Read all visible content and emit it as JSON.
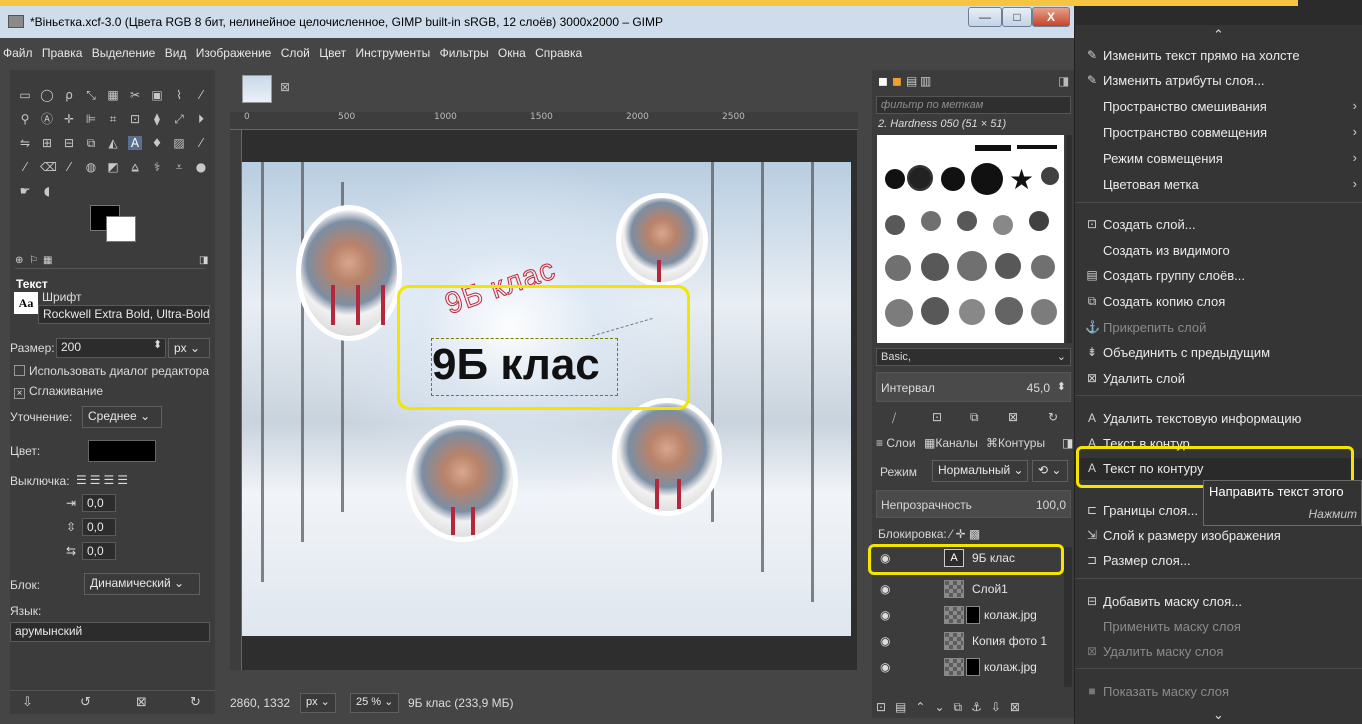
{
  "window": {
    "title": "*Віньєтка.xcf-3.0 (Цвета RGB 8 бит, нелинейное целочисленное, GIMP built-in sRGB, 12 слоёв) 3000x2000 – GIMP",
    "minimize": "—",
    "maximize": "□",
    "close": "X"
  },
  "menubar": [
    "Файл",
    "Правка",
    "Выделение",
    "Вид",
    "Изображение",
    "Слой",
    "Цвет",
    "Инструменты",
    "Фильтры",
    "Окна",
    "Справка"
  ],
  "tool_options": {
    "title": "Текст",
    "font_label": "Шрифт",
    "font_value": "Rockwell Extra Bold, Ultra-Bold",
    "size_label": "Размер:",
    "size_value": "200",
    "size_unit": "px",
    "use_editor": "Использовать диалог редактора",
    "antialias": "Сглаживание",
    "hinting_label": "Уточнение:",
    "hinting_value": "Среднее",
    "color_label": "Цвет:",
    "justify_label": "Выключка:",
    "indent": "0,0",
    "line_spacing": "0,0",
    "letter_spacing": "0,0",
    "box_label": "Блок:",
    "box_value": "Динамический",
    "lang_label": "Язык:",
    "lang_value": "арумынский",
    "fg_color": "#000000",
    "bg_color": "#ffffff"
  },
  "ruler": [
    "0",
    "500",
    "1000",
    "1500",
    "2000",
    "2500"
  ],
  "canvas": {
    "text": "9Б клас",
    "path_text": "9Б клас"
  },
  "status": {
    "coords": "2860, 1332",
    "unit": "px",
    "zoom": "25 %",
    "info": "9Б клас (233,9 МБ)"
  },
  "brushes": {
    "filter_placeholder": "фильтр по меткам",
    "current": "2. Hardness 050 (51 × 51)",
    "preset": "Basic,",
    "interval_label": "Интервал",
    "interval_value": "45,0"
  },
  "layers_dock": {
    "tabs": [
      "Слои",
      "Каналы",
      "Контуры"
    ],
    "mode_label": "Режим",
    "mode_value": "Нормальный",
    "opacity_label": "Непрозрачность",
    "opacity_value": "100,0",
    "lock_label": "Блокировка:",
    "layers": [
      "9Б клас",
      "Слой1",
      "колаж.jpg",
      "Копия фото 1",
      "колаж.jpg"
    ]
  },
  "context_menu": {
    "items": [
      {
        "label": "Изменить текст прямо на холсте",
        "icon": "pencil-icon"
      },
      {
        "label": "Изменить атрибуты слоя...",
        "icon": "pencil-icon"
      },
      {
        "label": "Пространство смешивания",
        "submenu": true
      },
      {
        "label": "Пространство совмещения",
        "submenu": true
      },
      {
        "label": "Режим совмещения",
        "submenu": true
      },
      {
        "label": "Цветовая метка",
        "submenu": true
      },
      {
        "label": "Создать слой...",
        "icon": "new-layer-icon"
      },
      {
        "label": "Создать из видимого"
      },
      {
        "label": "Создать группу слоёв...",
        "icon": "folder-icon"
      },
      {
        "label": "Создать копию слоя",
        "icon": "duplicate-icon"
      },
      {
        "label": "Прикрепить слой",
        "icon": "anchor-icon",
        "disabled": true
      },
      {
        "label": "Объединить с предыдущим",
        "icon": "merge-icon"
      },
      {
        "label": "Удалить слой",
        "icon": "delete-icon"
      },
      {
        "label": "Удалить текстовую информацию",
        "icon": "text-icon"
      },
      {
        "label": "Текст в контур",
        "icon": "text-icon"
      },
      {
        "label": "Текст по контуру",
        "icon": "text-icon"
      },
      {
        "label": "Границы слоя...",
        "icon": "bounds-icon"
      },
      {
        "label": "Слой к размеру изображения",
        "icon": "resize-icon"
      },
      {
        "label": "Размер слоя...",
        "icon": "scale-icon"
      },
      {
        "label": "Добавить маску слоя...",
        "icon": "mask-icon"
      },
      {
        "label": "Применить маску слоя",
        "disabled": true
      },
      {
        "label": "Удалить маску слоя",
        "icon": "delete-icon",
        "disabled": true
      },
      {
        "label": "Показать маску слоя",
        "icon": "checkbox-icon",
        "disabled": true
      }
    ],
    "tooltip_line1": "Направить текст этого",
    "tooltip_line2": "Нажмит"
  },
  "colors": {
    "highlight": "#f4e500",
    "title_bg": "#cfdcec",
    "panel_bg": "#454545"
  }
}
